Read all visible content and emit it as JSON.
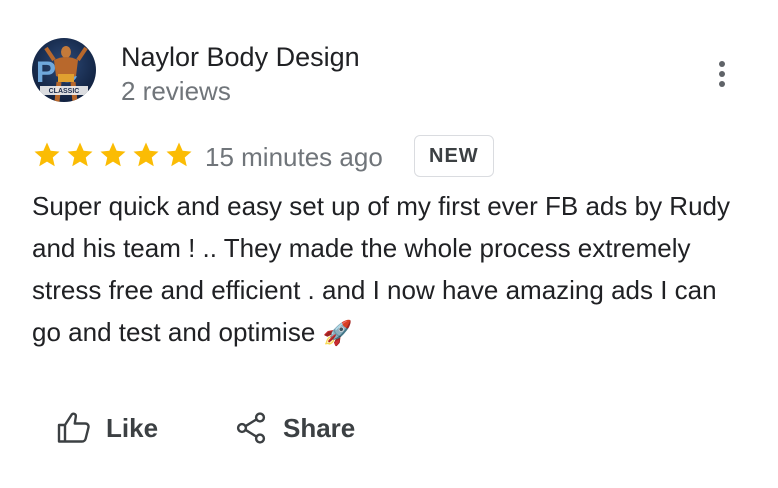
{
  "review": {
    "author": "Naylor Body Design",
    "review_count": "2 reviews",
    "rating": 5,
    "max_rating": 5,
    "time": "15 minutes ago",
    "badge": "NEW",
    "text": "Super quick and easy set up of my first ever FB ads by Rudy and his team ! .. They made the whole process extremely stress free and efficient . and I now have amazing ads I can go and test and optimise",
    "emoji": "🚀"
  },
  "avatar": {
    "letters": "PC",
    "banner_text": "CLASSIC"
  },
  "actions": {
    "like_label": "Like",
    "share_label": "Share"
  },
  "colors": {
    "star": "#fbbc04",
    "secondary_text": "#70757a",
    "primary_text": "#202124",
    "badge_border": "#dadce0"
  },
  "icons": {
    "menu": "more-vert-icon",
    "like": "thumb-up-outline-icon",
    "share": "share-icon",
    "star": "star-icon"
  }
}
